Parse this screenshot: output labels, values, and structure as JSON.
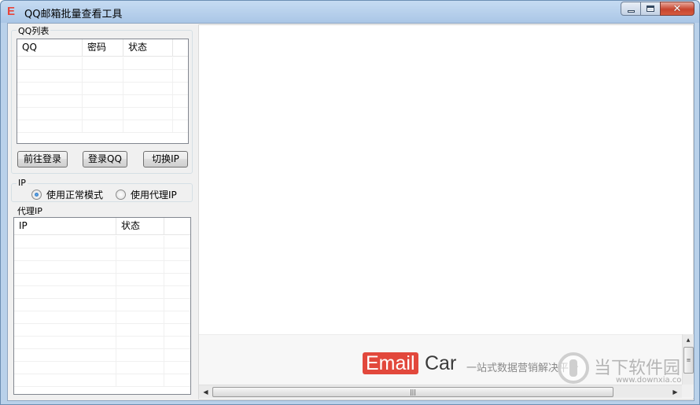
{
  "window": {
    "title": "QQ邮箱批量查看工具",
    "app_icon_letter": "E",
    "app_icon_color": "#e8443a",
    "controls": [
      "minimize-icon",
      "maximize-icon",
      "close-icon"
    ]
  },
  "qq_group": {
    "label": "QQ列表",
    "columns": [
      "QQ",
      "密码",
      "状态"
    ],
    "rows": []
  },
  "buttons": {
    "prev_login": "前往登录",
    "login_qq": "登录QQ",
    "switch_ip": "切换IP"
  },
  "ip_group": {
    "label": "IP",
    "options": [
      {
        "label": "使用正常模式",
        "checked": true
      },
      {
        "label": "使用代理IP",
        "checked": false
      }
    ]
  },
  "proxy_group": {
    "label": "代理IP",
    "columns": [
      "IP",
      "状态"
    ],
    "rows": []
  },
  "banner": {
    "brand_email": "Email",
    "brand_car": "Car",
    "slogan": "一站式数据营销解决平台",
    "brand_color": "#e2483c"
  },
  "watermark": {
    "text": "当下软件园",
    "url": "www.downxia.com"
  }
}
